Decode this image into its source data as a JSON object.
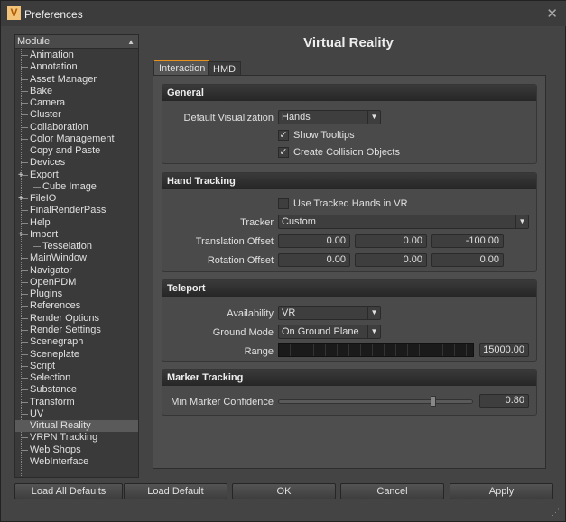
{
  "window": {
    "title": "Preferences",
    "close": "✕",
    "icon_letter": "V"
  },
  "tree": {
    "header": "Module",
    "items": [
      {
        "label": "Animation"
      },
      {
        "label": "Annotation"
      },
      {
        "label": "Asset Manager"
      },
      {
        "label": "Bake"
      },
      {
        "label": "Camera"
      },
      {
        "label": "Cluster"
      },
      {
        "label": "Collaboration"
      },
      {
        "label": "Color Management"
      },
      {
        "label": "Copy and Paste"
      },
      {
        "label": "Devices"
      },
      {
        "label": "Export",
        "expander": "+"
      },
      {
        "label": "Cube Image",
        "child": true
      },
      {
        "label": "FileIO",
        "expander": "+"
      },
      {
        "label": "FinalRenderPass"
      },
      {
        "label": "Help"
      },
      {
        "label": "Import",
        "expander": "+"
      },
      {
        "label": "Tesselation",
        "child": true
      },
      {
        "label": "MainWindow"
      },
      {
        "label": "Navigator"
      },
      {
        "label": "OpenPDM"
      },
      {
        "label": "Plugins"
      },
      {
        "label": "References"
      },
      {
        "label": "Render Options"
      },
      {
        "label": "Render Settings"
      },
      {
        "label": "Scenegraph"
      },
      {
        "label": "Sceneplate"
      },
      {
        "label": "Script"
      },
      {
        "label": "Selection"
      },
      {
        "label": "Substance"
      },
      {
        "label": "Transform"
      },
      {
        "label": "UV"
      },
      {
        "label": "Virtual Reality",
        "selected": true
      },
      {
        "label": "VRPN Tracking"
      },
      {
        "label": "Web Shops"
      },
      {
        "label": "WebInterface"
      }
    ]
  },
  "page": {
    "title": "Virtual Reality",
    "tabs": [
      "Interaction",
      "HMD"
    ]
  },
  "general": {
    "title": "General",
    "default_vis_label": "Default Visualization",
    "default_vis": "Hands",
    "show_tooltips": "Show Tooltips",
    "collision": "Create Collision Objects"
  },
  "hand": {
    "title": "Hand Tracking",
    "use_tracked": "Use Tracked Hands in VR",
    "tracker_label": "Tracker",
    "tracker": "Custom",
    "trans_label": "Translation Offset",
    "trans": [
      "0.00",
      "0.00",
      "-100.00"
    ],
    "rot_label": "Rotation Offset",
    "rot": [
      "0.00",
      "0.00",
      "0.00"
    ]
  },
  "teleport": {
    "title": "Teleport",
    "avail_label": "Availability",
    "avail": "VR",
    "ground_label": "Ground Mode",
    "ground": "On Ground Plane",
    "range_label": "Range",
    "range": "15000.00"
  },
  "marker": {
    "title": "Marker Tracking",
    "conf_label": "Min Marker Confidence",
    "conf": "0.80",
    "slider_fraction": 0.8
  },
  "buttons": [
    "Load All Defaults",
    "Load Default",
    "OK",
    "Cancel",
    "Apply"
  ]
}
